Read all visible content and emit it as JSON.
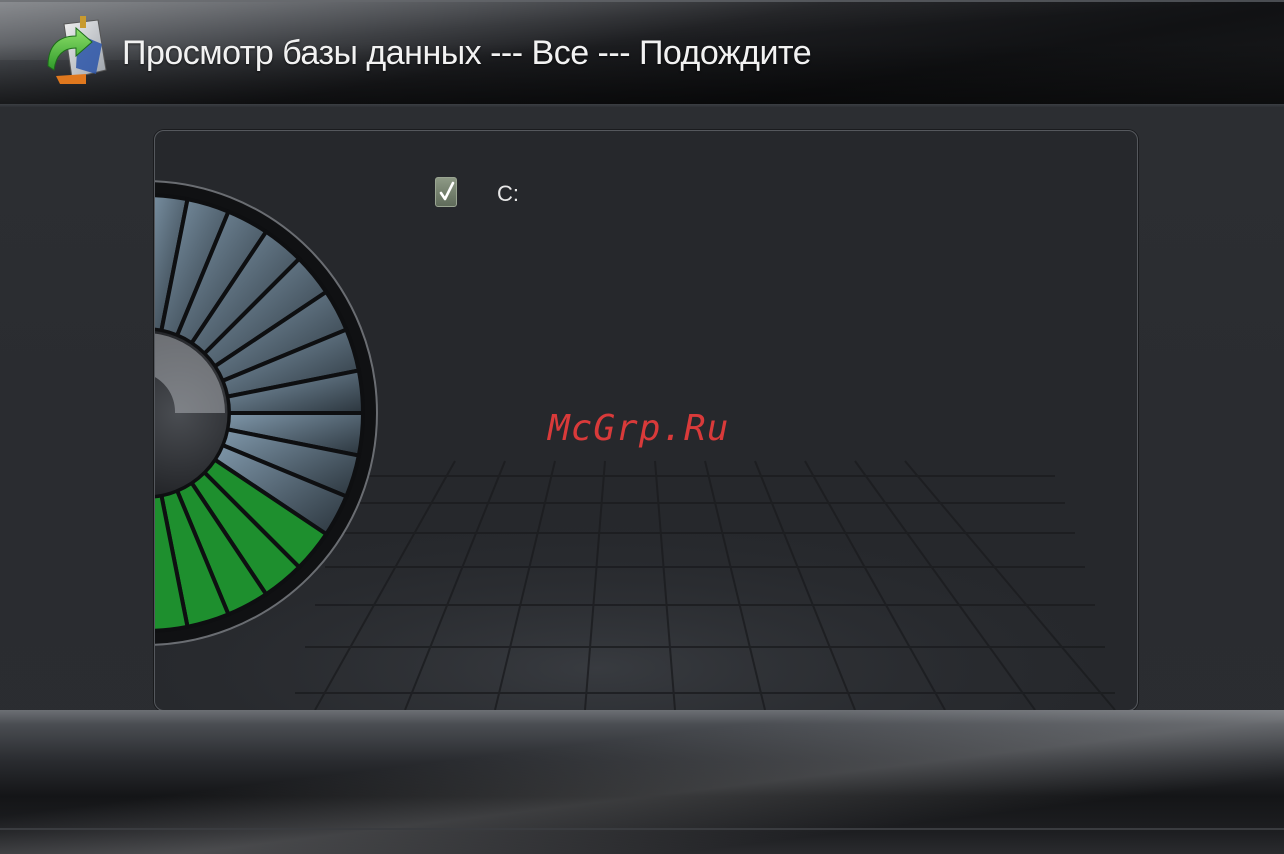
{
  "header": {
    "title": "Просмотр базы данных --- Все --- Подождите",
    "icon": "database-browser-icon"
  },
  "panel": {
    "drive_checkbox_checked": true,
    "drive_label": "C:",
    "progress": {
      "segments_total": 16,
      "segments_complete": 5,
      "fill_color": "#1e8f2e"
    }
  },
  "watermark": {
    "text": "McGrp.Ru",
    "color": "#d93a3a"
  }
}
